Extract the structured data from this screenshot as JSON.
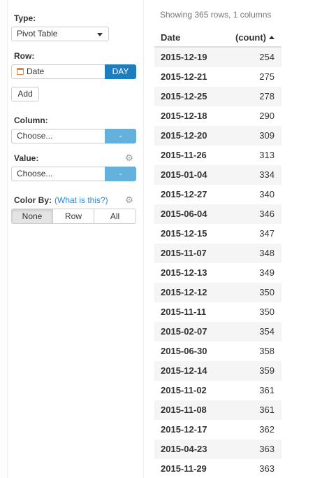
{
  "controls": {
    "type_label": "Type:",
    "type_value": "Pivot Table",
    "row_label": "Row:",
    "row_field": "Date",
    "row_grain": "DAY",
    "add_label": "Add",
    "column_label": "Column:",
    "column_placeholder": "Choose...",
    "column_btn": "-",
    "value_label": "Value:",
    "value_placeholder": "Choose...",
    "value_btn": "-",
    "colorby_label": "Color By:",
    "colorby_help": "(What is this?)",
    "colorby_options": [
      "None",
      "Row",
      "All"
    ],
    "colorby_selected": "None"
  },
  "table": {
    "row_count_text": "Showing 365 rows, 1 columns",
    "headers": [
      "Date",
      "(count)"
    ],
    "sort": "ascending",
    "rows": [
      [
        "2015-12-19",
        "254"
      ],
      [
        "2015-12-21",
        "275"
      ],
      [
        "2015-12-25",
        "278"
      ],
      [
        "2015-12-18",
        "290"
      ],
      [
        "2015-12-20",
        "309"
      ],
      [
        "2015-11-26",
        "313"
      ],
      [
        "2015-01-04",
        "334"
      ],
      [
        "2015-12-27",
        "340"
      ],
      [
        "2015-06-04",
        "346"
      ],
      [
        "2015-12-15",
        "347"
      ],
      [
        "2015-11-07",
        "348"
      ],
      [
        "2015-12-13",
        "349"
      ],
      [
        "2015-12-12",
        "350"
      ],
      [
        "2015-11-11",
        "350"
      ],
      [
        "2015-02-07",
        "354"
      ],
      [
        "2015-06-30",
        "358"
      ],
      [
        "2015-12-14",
        "359"
      ],
      [
        "2015-11-02",
        "361"
      ],
      [
        "2015-11-08",
        "361"
      ],
      [
        "2015-12-17",
        "362"
      ],
      [
        "2015-04-23",
        "363"
      ],
      [
        "2015-11-29",
        "363"
      ]
    ]
  },
  "colors": {
    "accent_dark": "#1c7dbf",
    "accent_light": "#64b1dd",
    "link": "#2a8bd0"
  }
}
